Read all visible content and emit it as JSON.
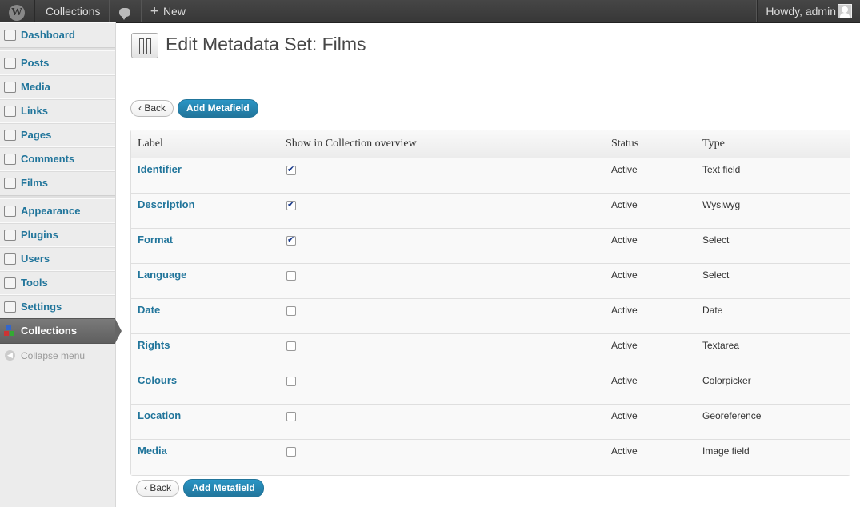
{
  "adminbar": {
    "site_name": "Collections",
    "new_label": "New",
    "howdy": "Howdy, admin"
  },
  "sidebar": {
    "items": [
      {
        "label": "Dashboard",
        "icon": "dashboard-icon"
      },
      {
        "label": "Posts",
        "icon": "pin-icon"
      },
      {
        "label": "Media",
        "icon": "media-icon"
      },
      {
        "label": "Links",
        "icon": "link-icon"
      },
      {
        "label": "Pages",
        "icon": "pages-icon"
      },
      {
        "label": "Comments",
        "icon": "comments-icon"
      },
      {
        "label": "Films",
        "icon": "film-icon"
      },
      {
        "label": "Appearance",
        "icon": "appearance-icon"
      },
      {
        "label": "Plugins",
        "icon": "plugin-icon"
      },
      {
        "label": "Users",
        "icon": "users-icon"
      },
      {
        "label": "Tools",
        "icon": "tools-icon"
      },
      {
        "label": "Settings",
        "icon": "settings-icon"
      },
      {
        "label": "Collections",
        "icon": "collections-icon"
      }
    ],
    "collapse_label": "Collapse menu"
  },
  "main": {
    "title": "Edit Metadata Set: Films",
    "back_label": "‹ Back",
    "add_label": "Add Metafield"
  },
  "table": {
    "headers": {
      "label": "Label",
      "show": "Show in Collection overview",
      "status": "Status",
      "type": "Type"
    },
    "rows": [
      {
        "label": "Identifier",
        "checked": true,
        "status": "Active",
        "type": "Text field"
      },
      {
        "label": "Description",
        "checked": true,
        "status": "Active",
        "type": "Wysiwyg"
      },
      {
        "label": "Format",
        "checked": true,
        "status": "Active",
        "type": "Select"
      },
      {
        "label": "Language",
        "checked": false,
        "status": "Active",
        "type": "Select"
      },
      {
        "label": "Date",
        "checked": false,
        "status": "Active",
        "type": "Date"
      },
      {
        "label": "Rights",
        "checked": false,
        "status": "Active",
        "type": "Textarea"
      },
      {
        "label": "Colours",
        "checked": false,
        "status": "Active",
        "type": "Colorpicker"
      },
      {
        "label": "Location",
        "checked": false,
        "status": "Active",
        "type": "Georeference"
      },
      {
        "label": "Media",
        "checked": false,
        "status": "Active",
        "type": "Image field"
      }
    ]
  },
  "colors": {
    "link": "#21759b",
    "adminbar": "#464646",
    "active_menu": "#6d6d6d"
  }
}
